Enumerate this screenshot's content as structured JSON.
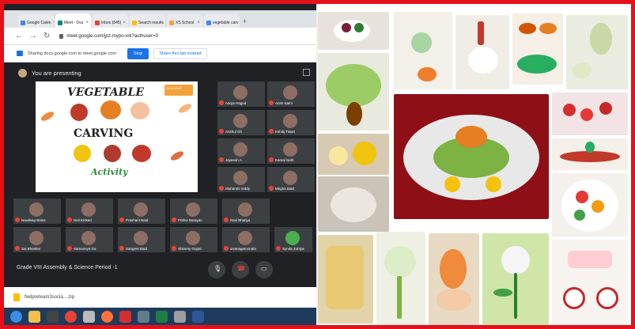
{
  "browser": {
    "tabs": [
      {
        "label": "Google Calen",
        "color": "#4285f4"
      },
      {
        "label": "Meet - Dvu",
        "color": "#00897b",
        "active": true
      },
      {
        "label": "Inbox (845)",
        "color": "#ea4335"
      },
      {
        "label": "Search results",
        "color": "#fbbc04"
      },
      {
        "label": "XS School",
        "color": "#f2a23a"
      },
      {
        "label": "vegetable carv",
        "color": "#4285f4"
      }
    ],
    "url": "meet.google.com/jpz-mypo-vrk?authuser=0",
    "share_notice": "Sharing docs.google.com to meet.google.com",
    "stop_label": "Stop",
    "share_tab_label": "Share this tab instead"
  },
  "meet": {
    "presenting_text": "You are presenting",
    "slide": {
      "line1": "VEGETABLE",
      "line2": "CARVING",
      "line3": "Activity",
      "logo_text": "SCHOOLS"
    },
    "participants": [
      "Aarya Hagud",
      "Ansh Sami",
      "Anshul Gh",
      "Kshitij Tiwari",
      "Jayeesh A.",
      "Kamal Nath",
      "Maharshi reddy",
      "Megha Baid",
      "Navdeep Bains",
      "Neil Kinked",
      "Prashant Baid",
      "Prithvi Narayan",
      "Ravi Bhatiya",
      "Sai Bhaskar",
      "Samanvya Ga",
      "Sangeet Baid",
      "Shimmy Gupta",
      "sivanagamonala",
      "Synda Zubiya"
    ],
    "meeting_title": "Grade VIII Assembly & Science Period -1"
  },
  "download": {
    "filename": "fwdpreteam3socia....zip"
  }
}
